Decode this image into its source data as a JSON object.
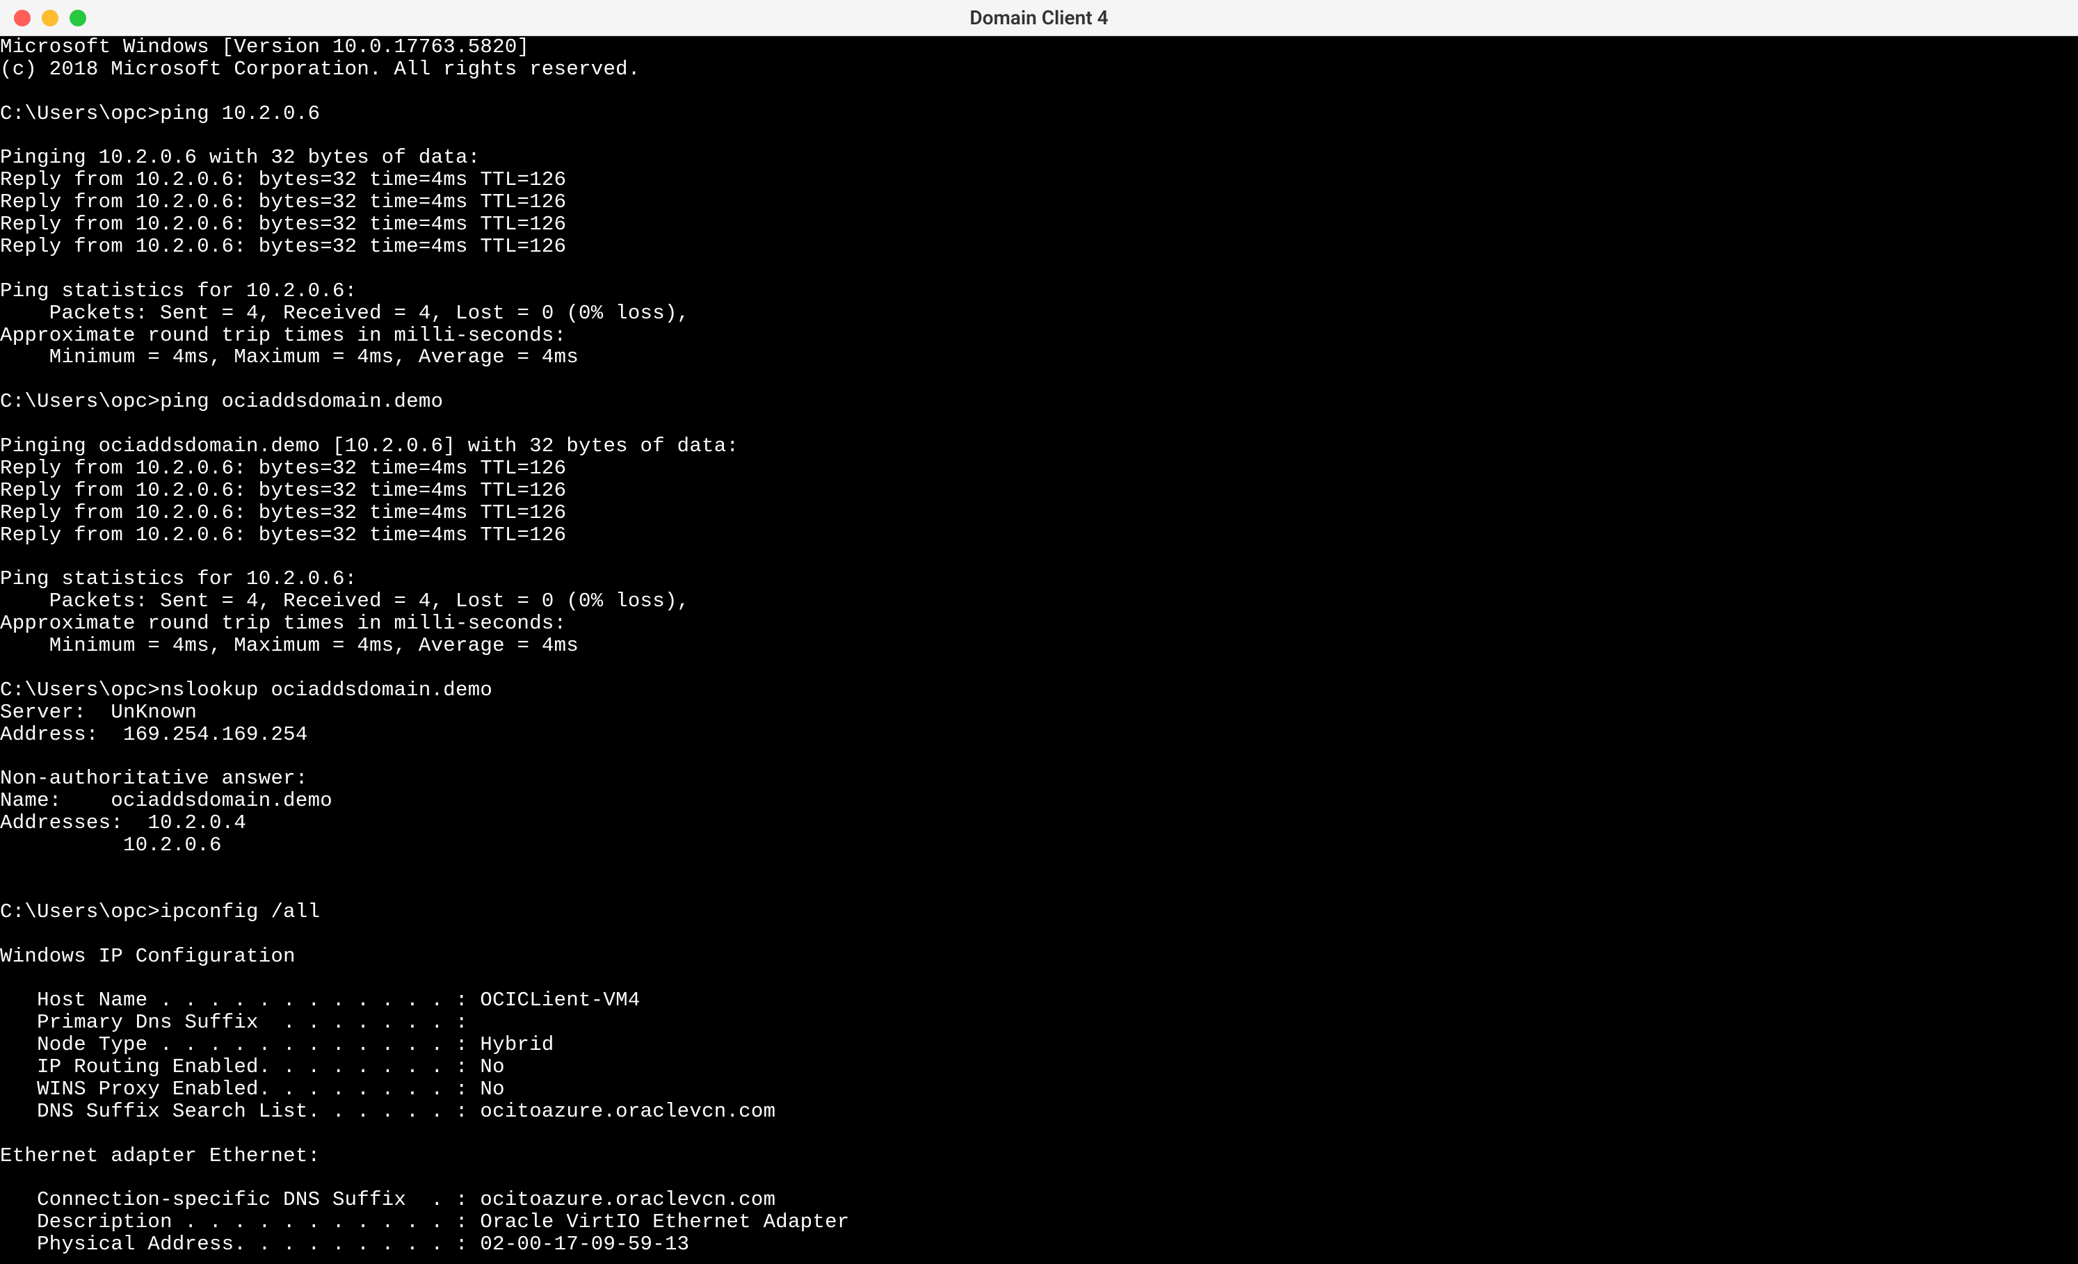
{
  "window": {
    "title": "Domain Client 4"
  },
  "terminal": {
    "lines": [
      "Microsoft Windows [Version 10.0.17763.5820]",
      "(c) 2018 Microsoft Corporation. All rights reserved.",
      "",
      "C:\\Users\\opc>ping 10.2.0.6",
      "",
      "Pinging 10.2.0.6 with 32 bytes of data:",
      "Reply from 10.2.0.6: bytes=32 time=4ms TTL=126",
      "Reply from 10.2.0.6: bytes=32 time=4ms TTL=126",
      "Reply from 10.2.0.6: bytes=32 time=4ms TTL=126",
      "Reply from 10.2.0.6: bytes=32 time=4ms TTL=126",
      "",
      "Ping statistics for 10.2.0.6:",
      "    Packets: Sent = 4, Received = 4, Lost = 0 (0% loss),",
      "Approximate round trip times in milli-seconds:",
      "    Minimum = 4ms, Maximum = 4ms, Average = 4ms",
      "",
      "C:\\Users\\opc>ping ociaddsdomain.demo",
      "",
      "Pinging ociaddsdomain.demo [10.2.0.6] with 32 bytes of data:",
      "Reply from 10.2.0.6: bytes=32 time=4ms TTL=126",
      "Reply from 10.2.0.6: bytes=32 time=4ms TTL=126",
      "Reply from 10.2.0.6: bytes=32 time=4ms TTL=126",
      "Reply from 10.2.0.6: bytes=32 time=4ms TTL=126",
      "",
      "Ping statistics for 10.2.0.6:",
      "    Packets: Sent = 4, Received = 4, Lost = 0 (0% loss),",
      "Approximate round trip times in milli-seconds:",
      "    Minimum = 4ms, Maximum = 4ms, Average = 4ms",
      "",
      "C:\\Users\\opc>nslookup ociaddsdomain.demo",
      "Server:  UnKnown",
      "Address:  169.254.169.254",
      "",
      "Non-authoritative answer:",
      "Name:    ociaddsdomain.demo",
      "Addresses:  10.2.0.4",
      "          10.2.0.6",
      "",
      "",
      "C:\\Users\\opc>ipconfig /all",
      "",
      "Windows IP Configuration",
      "",
      "   Host Name . . . . . . . . . . . . : OCICLient-VM4",
      "   Primary Dns Suffix  . . . . . . . :",
      "   Node Type . . . . . . . . . . . . : Hybrid",
      "   IP Routing Enabled. . . . . . . . : No",
      "   WINS Proxy Enabled. . . . . . . . : No",
      "   DNS Suffix Search List. . . . . . : ocitoazure.oraclevcn.com",
      "",
      "Ethernet adapter Ethernet:",
      "",
      "   Connection-specific DNS Suffix  . : ocitoazure.oraclevcn.com",
      "   Description . . . . . . . . . . . : Oracle VirtIO Ethernet Adapter",
      "   Physical Address. . . . . . . . . : 02-00-17-09-59-13"
    ]
  }
}
